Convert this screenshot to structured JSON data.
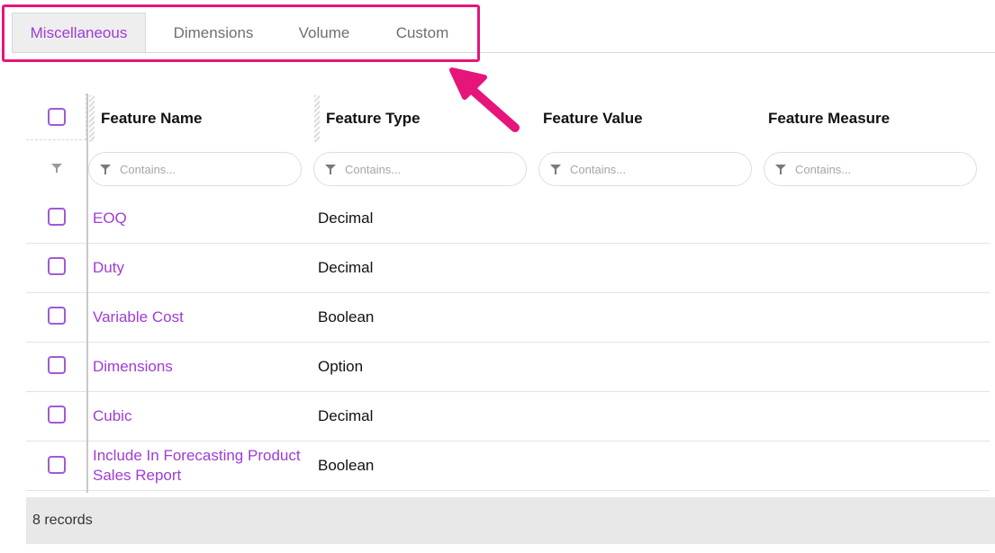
{
  "tabs": [
    {
      "label": "Miscellaneous",
      "active": true
    },
    {
      "label": "Dimensions",
      "active": false
    },
    {
      "label": "Volume",
      "active": false
    },
    {
      "label": "Custom",
      "active": false
    }
  ],
  "grid": {
    "columns": [
      "Feature Name",
      "Feature Type",
      "Feature Value",
      "Feature Measure"
    ],
    "filter_placeholder": "Contains...",
    "rows": [
      {
        "name": "EOQ",
        "type": "Decimal"
      },
      {
        "name": "Duty",
        "type": "Decimal"
      },
      {
        "name": "Variable Cost",
        "type": "Boolean"
      },
      {
        "name": "Dimensions",
        "type": "Option"
      },
      {
        "name": "Cubic",
        "type": "Decimal"
      },
      {
        "name": "Include In Forecasting Product Sales Report",
        "type": "Boolean"
      }
    ],
    "record_count": "8 records"
  },
  "colors": {
    "accent": "#a03bd8",
    "highlight": "#e6157a",
    "checkbox_border": "#a05ad6"
  },
  "icons": {
    "filter": "funnel-icon",
    "annotation": "arrow-icon"
  }
}
